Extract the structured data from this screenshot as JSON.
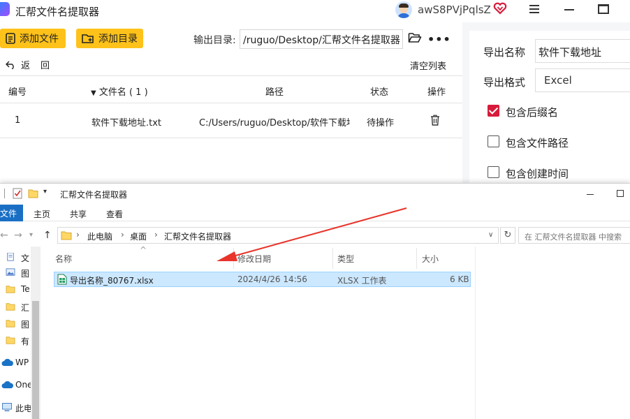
{
  "app": {
    "title": "汇帮文件名提取器",
    "username": "awS8PVjPqlsZ",
    "icons": {
      "logo": "app-logo-icon",
      "avatar": "user-avatar",
      "vip": "vip-heart-icon",
      "menu": "hamburger-icon",
      "minimize": "minimize-icon",
      "maximize": "maximize-icon"
    },
    "accent": "#ffc21a",
    "check_color": "#d81b3b"
  },
  "toolbar": {
    "add_file": "添加文件",
    "add_dir": "添加目录",
    "output_label": "输出目录:",
    "output_path": "/ruguo/Desktop/汇帮文件名提取器",
    "more": "•••"
  },
  "subbar": {
    "back": "返",
    "refresh": "回",
    "clear": "清空列表"
  },
  "table": {
    "headers": {
      "index": "编号",
      "filename": "文件名 ( 1 )",
      "path": "路径",
      "status": "状态",
      "action": "操作"
    },
    "rows": [
      {
        "index": "1",
        "filename": "软件下载地址.txt",
        "path": "C:/Users/ruguo/Desktop/软件下载地址",
        "status": "待操作"
      }
    ]
  },
  "settings": {
    "export_name_label": "导出名称",
    "export_name_value": "软件下载地址",
    "export_format_label": "导出格式",
    "export_format_value": "Excel",
    "options": [
      {
        "label": "包含后缀名",
        "checked": true
      },
      {
        "label": "包含文件路径",
        "checked": false
      },
      {
        "label": "包含创建时间",
        "checked": false
      }
    ]
  },
  "explorer": {
    "title": "汇帮文件名提取器",
    "ribbon": {
      "file": "文件",
      "home": "主页",
      "share": "共享",
      "view": "查看"
    },
    "breadcrumb": [
      "此电脑",
      "桌面",
      "汇帮文件名提取器"
    ],
    "search_placeholder": "在 汇帮文件名提取器 中搜索",
    "nav_items": [
      {
        "label": "文",
        "icon": "document-icon"
      },
      {
        "label": "图",
        "icon": "picture-icon"
      },
      {
        "label": "Te",
        "icon": "folder-icon"
      },
      {
        "label": "汇",
        "icon": "folder-icon"
      },
      {
        "label": "图",
        "icon": "folder-icon"
      },
      {
        "label": "有",
        "icon": "folder-icon"
      },
      {
        "label": "WP",
        "icon": "cloud-icon"
      },
      {
        "label": "One",
        "icon": "cloud-icon"
      },
      {
        "label": "此电",
        "icon": "computer-icon"
      }
    ],
    "columns": {
      "name": "名称",
      "modified": "修改日期",
      "type": "类型",
      "size": "大小"
    },
    "files": [
      {
        "name": "导出名称_80767.xlsx",
        "modified": "2024/4/26 14:56",
        "type": "XLSX 工作表",
        "size": "6 KB"
      }
    ]
  }
}
